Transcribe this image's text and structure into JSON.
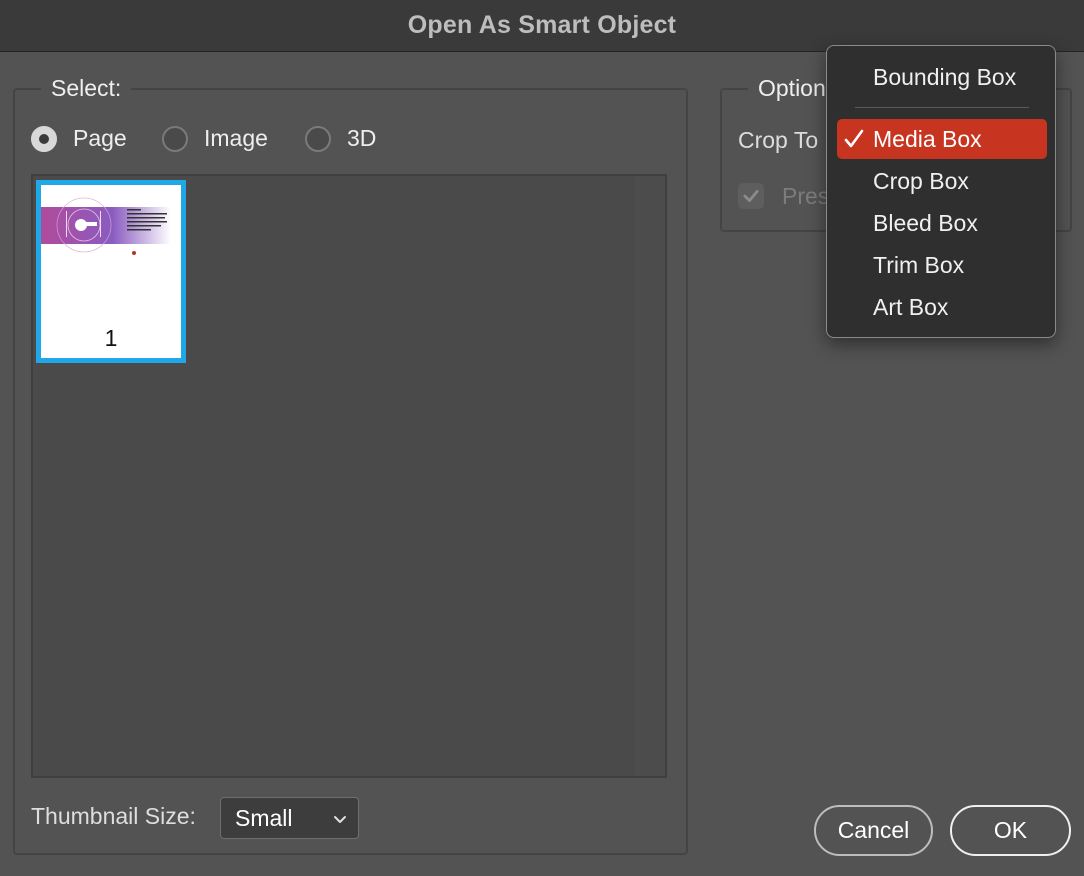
{
  "window": {
    "title": "Open As Smart Object"
  },
  "select_group": {
    "label": "Select:",
    "radios": [
      {
        "label": "Page",
        "checked": true
      },
      {
        "label": "Image",
        "checked": false
      },
      {
        "label": "3D",
        "checked": false
      }
    ]
  },
  "thumbnails": [
    {
      "page_number": "1",
      "selected": true
    }
  ],
  "thumbnail_size": {
    "label": "Thumbnail Size:",
    "value": "Small"
  },
  "options_group": {
    "label": "Option",
    "crop_to_label": "Crop To",
    "preserve_label": "Pres",
    "preserve_checked": true
  },
  "crop_menu": {
    "items": [
      {
        "label": "Bounding Box",
        "selected": false
      },
      {
        "label": "Media Box",
        "selected": true
      },
      {
        "label": "Crop Box",
        "selected": false
      },
      {
        "label": "Bleed Box",
        "selected": false
      },
      {
        "label": "Trim Box",
        "selected": false
      },
      {
        "label": "Art Box",
        "selected": false
      }
    ]
  },
  "buttons": {
    "cancel": "Cancel",
    "ok": "OK"
  },
  "colors": {
    "background": "#535353",
    "selection_border": "#1fa7e8",
    "menu_highlight": "#c7341f"
  },
  "icons": {
    "check": "checkmark-icon",
    "chevron": "chevron-down-icon"
  }
}
